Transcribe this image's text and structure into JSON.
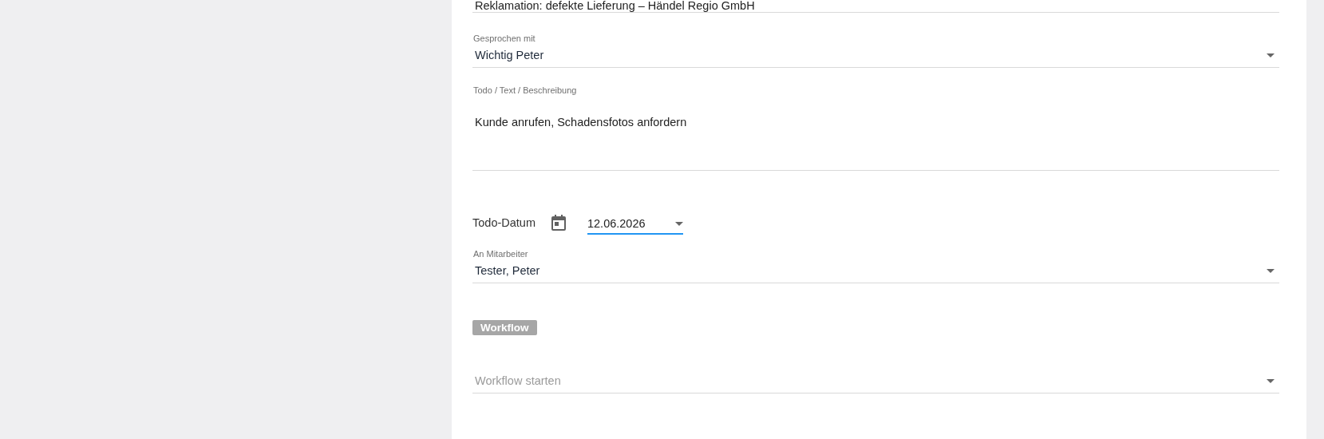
{
  "subject": {
    "value": "Reklamation: defekte Lieferung – Händel Regio GmbH"
  },
  "contact": {
    "label": "Gesprochen mit",
    "value": "Wichtig Peter"
  },
  "description": {
    "label": "Todo / Text / Beschreibung",
    "value": "Kunde anrufen, Schadensfotos anfordern"
  },
  "todo_date": {
    "label": "Todo-Datum",
    "value": "12.06.2026",
    "focused": true
  },
  "assignee": {
    "label": "An Mitarbeiter",
    "value": "Tester, Peter"
  },
  "workflow": {
    "badge": "Workflow",
    "select": {
      "placeholder": "Workflow starten"
    }
  }
}
